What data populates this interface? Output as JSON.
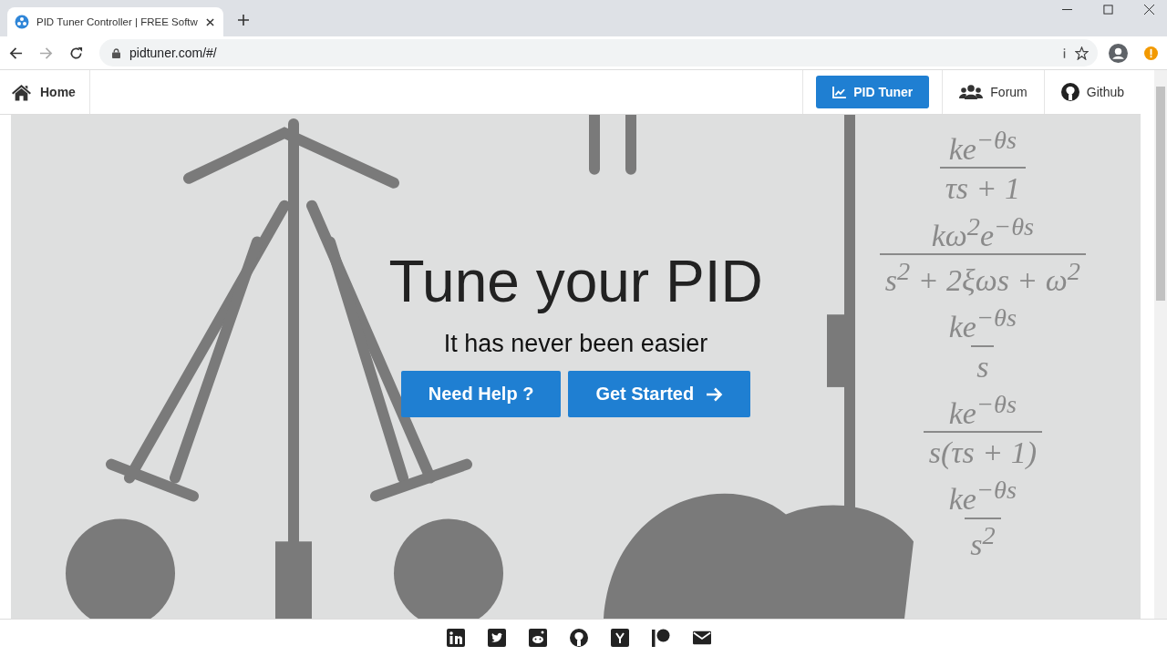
{
  "browser": {
    "tab_title": "PID Tuner Controller | FREE Softw",
    "url": "pidtuner.com/#/"
  },
  "nav": {
    "home": "Home",
    "items": [
      {
        "label": "PID Tuner",
        "selected": true
      },
      {
        "label": "Forum",
        "selected": false
      },
      {
        "label": "Github",
        "selected": false
      }
    ]
  },
  "hero": {
    "title": "Tune your PID",
    "subtitle": "It has never been easier",
    "buttons": [
      {
        "label": "Need Help ?",
        "kind": "plain"
      },
      {
        "label": "Get Started",
        "kind": "arrow"
      }
    ],
    "formulas": [
      {
        "numerator": "ke$^{−θs}$",
        "denominator": "τs + 1"
      },
      {
        "numerator": "kω$^{2}$e$^{−θs}$",
        "denominator": "s$^{2}$ + 2ξωs + ω$^{2}$"
      },
      {
        "numerator": "ke$^{−θs}$",
        "denominator": "s"
      },
      {
        "numerator": "ke$^{−θs}$",
        "denominator": "s(τs + 1)"
      },
      {
        "numerator": "ke$^{−θs}$",
        "denominator": "s$^{2}$"
      }
    ]
  }
}
